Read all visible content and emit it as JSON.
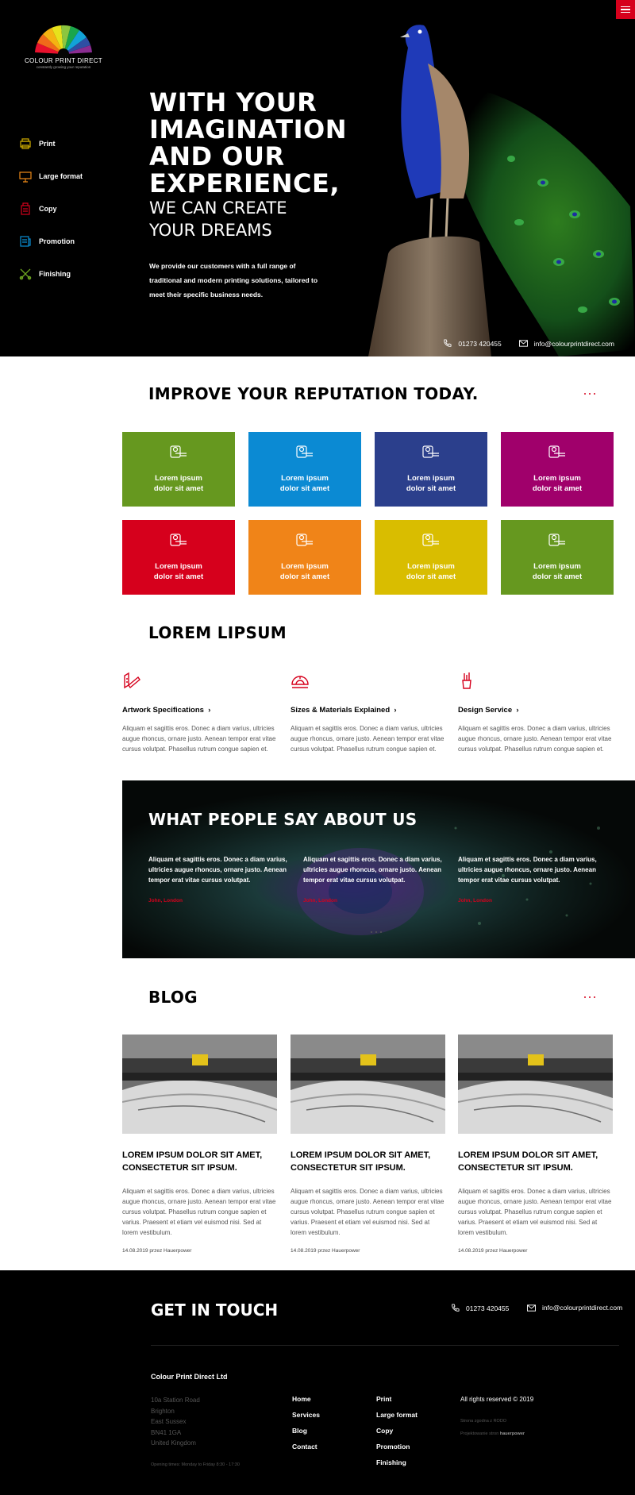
{
  "brand": {
    "name": "COLOUR PRINT DIRECT",
    "tagline": "constantly growing your reputation"
  },
  "sidebar": {
    "items": [
      {
        "label": "Print",
        "icon": "print-icon",
        "color": "#d4b000"
      },
      {
        "label": "Large format",
        "icon": "large-format-icon",
        "color": "#ef8a17"
      },
      {
        "label": "Copy",
        "icon": "copy-icon",
        "color": "#d6001c"
      },
      {
        "label": "Promotion",
        "icon": "promotion-icon",
        "color": "#0a8fd6"
      },
      {
        "label": "Finishing",
        "icon": "finishing-icon",
        "color": "#6aa120"
      }
    ]
  },
  "hero": {
    "headline_lines": [
      "WITH YOUR",
      "IMAGINATION",
      "AND OUR",
      "EXPERIENCE,"
    ],
    "subheadline_lines": [
      "WE CAN CREATE",
      "YOUR DREAMS"
    ],
    "description": "We provide our customers with a full range of traditional and modern printing solutions, tailored to meet their specific business needs.",
    "phone": "01273 420455",
    "email": "info@colourprintdirect.com"
  },
  "reputation": {
    "title": "IMPROVE YOUR REPUTATION TODAY.",
    "tiles": [
      {
        "label": "Lorem ipsum dolor sit amet",
        "color": "#66981f"
      },
      {
        "label": "Lorem ipsum dolor sit amet",
        "color": "#0b8ad3"
      },
      {
        "label": "Lorem ipsum dolor sit amet",
        "color": "#2b3f8c"
      },
      {
        "label": "Lorem ipsum dolor sit amet",
        "color": "#a0006b"
      },
      {
        "label": "Lorem ipsum dolor sit amet",
        "color": "#d6001c"
      },
      {
        "label": "Lorem ipsum dolor sit amet",
        "color": "#f08418"
      },
      {
        "label": "Lorem ipsum dolor sit amet",
        "color": "#d9bd00"
      },
      {
        "label": "Lorem ipsum dolor sit amet",
        "color": "#66981f"
      }
    ]
  },
  "features": {
    "title": "LOREM LIPSUM",
    "items": [
      {
        "title": "Artwork Specifications",
        "text": "Aliquam et sagittis eros. Donec a diam varius, ultricies augue rhoncus, ornare justo. Aenean tempor erat vitae cursus volutpat. Phasellus rutrum congue sapien et."
      },
      {
        "title": "Sizes & Materials Explained",
        "text": "Aliquam et sagittis eros. Donec a diam varius, ultricies augue rhoncus, ornare justo. Aenean tempor erat vitae cursus volutpat. Phasellus rutrum congue sapien et."
      },
      {
        "title": "Design Service",
        "text": "Aliquam et sagittis eros. Donec a diam varius, ultricies augue rhoncus, ornare justo. Aenean tempor erat vitae cursus volutpat. Phasellus rutrum congue sapien et."
      }
    ]
  },
  "testimonials": {
    "title": "WHAT PEOPLE SAY ABOUT US",
    "items": [
      {
        "quote": "Aliquam et sagittis eros. Donec a diam varius, ultricies augue rhoncus, ornare justo. Aenean tempor erat vitae cursus volutpat.",
        "author": "John, London"
      },
      {
        "quote": "Aliquam et sagittis eros. Donec a diam varius, ultricies augue rhoncus, ornare justo. Aenean tempor erat vitae cursus volutpat.",
        "author": "John, London"
      },
      {
        "quote": "Aliquam et sagittis eros. Donec a diam varius, ultricies augue rhoncus, ornare justo. Aenean tempor erat vitae cursus volutpat.",
        "author": "John, London"
      }
    ]
  },
  "blog": {
    "title": "BLOG",
    "posts": [
      {
        "title": "LOREM IPSUM DOLOR SIT AMET, CONSECTETUR SIT IPSUM.",
        "text": "Aliquam et sagittis eros. Donec a diam varius, ultricies augue rhoncus, ornare justo. Aenean tempor erat vitae cursus volutpat. Phasellus rutrum congue sapien et varius. Praesent et etiam vel euismod nisi. Sed at lorem vestibulum.",
        "meta": "14.08.2019 przez Hauerpower"
      },
      {
        "title": "LOREM IPSUM DOLOR SIT AMET, CONSECTETUR SIT IPSUM.",
        "text": "Aliquam et sagittis eros. Donec a diam varius, ultricies augue rhoncus, ornare justo. Aenean tempor erat vitae cursus volutpat. Phasellus rutrum congue sapien et varius. Praesent et etiam vel euismod nisi. Sed at lorem vestibulum.",
        "meta": "14.08.2019 przez Hauerpower"
      },
      {
        "title": "LOREM IPSUM DOLOR SIT AMET, CONSECTETUR SIT IPSUM.",
        "text": "Aliquam et sagittis eros. Donec a diam varius, ultricies augue rhoncus, ornare justo. Aenean tempor erat vitae cursus volutpat. Phasellus rutrum congue sapien et varius. Praesent et etiam vel euismod nisi. Sed at lorem vestibulum.",
        "meta": "14.08.2019 przez Hauerpower"
      }
    ]
  },
  "footer": {
    "title": "GET IN TOUCH",
    "phone": "01273 420455",
    "email": "info@colourprintdirect.com",
    "company": "Colour Print Direct Ltd",
    "address": [
      "10a Station Road",
      "Brighton",
      "East Sussex",
      "BN41 1GA",
      "United Kingdom"
    ],
    "hours": "Opening times: Monday to Friday 8:30 - 17:30",
    "nav1": [
      "Home",
      "Services",
      "Blog",
      "Contact"
    ],
    "nav2": [
      "Print",
      "Large format",
      "Copy",
      "Promotion",
      "Finishing"
    ],
    "rights": "All rights reserved © 2019",
    "rodo": "Strona zgodna z RODO",
    "credit_prefix": "Projektowanie stron",
    "credit_name": "hauerpower"
  },
  "colors": {
    "accent": "#d6001c"
  }
}
